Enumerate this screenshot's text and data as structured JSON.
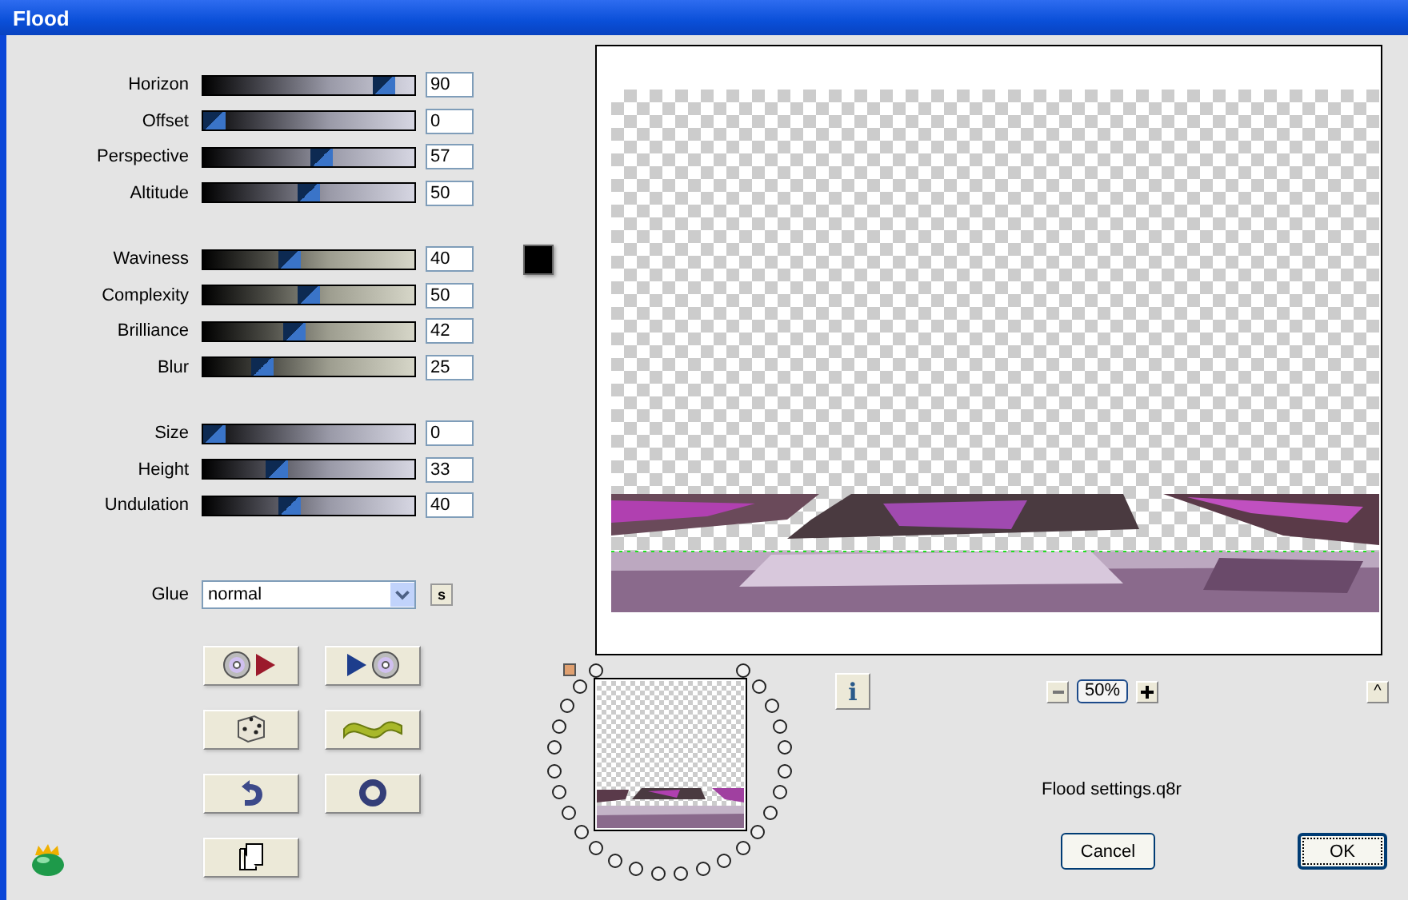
{
  "window": {
    "title": "Flood"
  },
  "slider_groups": [
    {
      "kind": "cool",
      "sliders": [
        {
          "label": "Horizon",
          "value": "90",
          "level": 0.9
        },
        {
          "label": "Offset",
          "value": "0",
          "level": 0
        },
        {
          "label": "Perspective",
          "value": "57",
          "level": 0.57
        },
        {
          "label": "Altitude",
          "value": "50",
          "level": 0.5
        }
      ]
    },
    {
      "kind": "warm",
      "sliders": [
        {
          "label": "Waviness",
          "value": "40",
          "level": 0.4
        },
        {
          "label": "Complexity",
          "value": "50",
          "level": 0.5
        },
        {
          "label": "Brilliance",
          "value": "42",
          "level": 0.42
        },
        {
          "label": "Blur",
          "value": "25",
          "level": 0.25
        }
      ]
    },
    {
      "kind": "cool",
      "sliders": [
        {
          "label": "Size",
          "value": "0",
          "level": 0
        },
        {
          "label": "Height",
          "value": "33",
          "level": 0.33
        },
        {
          "label": "Undulation",
          "value": "40",
          "level": 0.4
        }
      ]
    }
  ],
  "glue": {
    "label": "Glue",
    "value": "normal",
    "side_button": "s"
  },
  "info_button": "i",
  "zoom": {
    "value": "50%"
  },
  "collapse_button": "^",
  "settings_file": "Flood settings.q8r",
  "buttons": [
    {
      "label": "Cancel",
      "default": false
    },
    {
      "label": "OK",
      "default": true
    }
  ]
}
